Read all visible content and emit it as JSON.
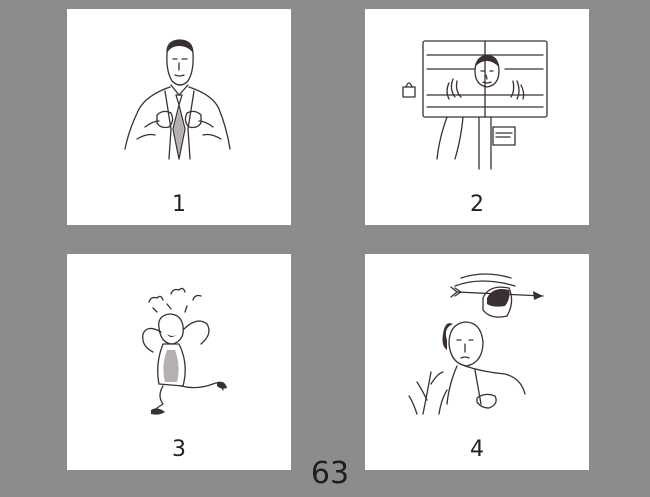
{
  "cards": [
    {
      "number": "1",
      "icon": "man-adjusting-tie-illustration"
    },
    {
      "number": "2",
      "icon": "boy-in-stocks-illustration"
    },
    {
      "number": "3",
      "icon": "angry-man-stomping-illustration"
    },
    {
      "number": "4",
      "icon": "man-with-arrow-through-hat-illustration"
    }
  ],
  "page_number": "63",
  "colors": {
    "background": "#8e8c8a",
    "card": "#ffffff",
    "ink": "#3a3034"
  }
}
